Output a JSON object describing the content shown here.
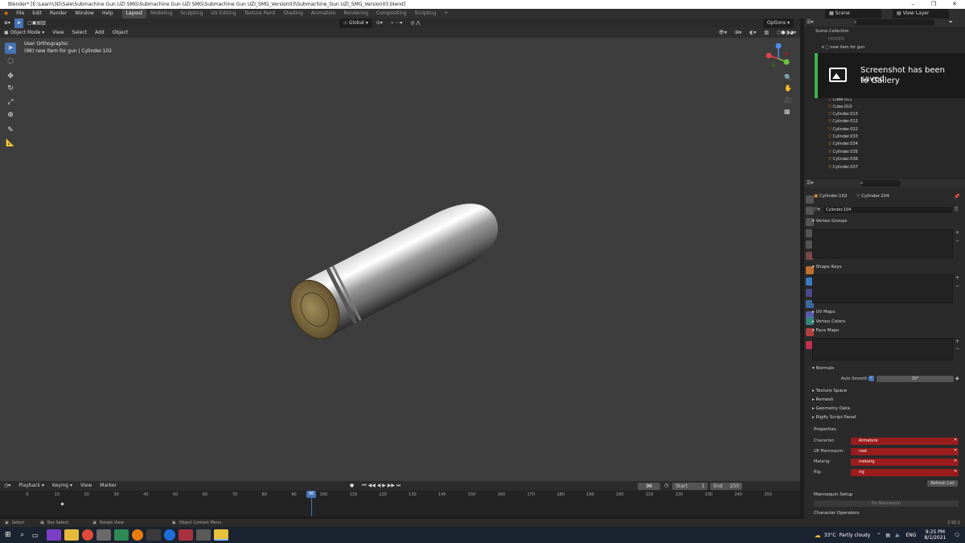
{
  "window": {
    "title": "Blender* [E:\\Learn\\3D\\Sale\\Submachine Gun UZI SMG\\Submachine Gun UZI SMG\\Submachine Gun UZI_SMG_Version03\\Submachine_Gun UZI_SMG_Version03.blend]"
  },
  "menu": [
    "File",
    "Edit",
    "Render",
    "Window",
    "Help"
  ],
  "workspaces": [
    "Layout",
    "Modeling",
    "Sculpting",
    "UV Editing",
    "Texture Paint",
    "Shading",
    "Animation",
    "Rendering",
    "Compositing",
    "Scripting"
  ],
  "active_workspace": "Layout",
  "header_right": {
    "scene": "Scene",
    "view_layer": "View Layer"
  },
  "viewport": {
    "mode": "Object Mode",
    "menus": [
      "View",
      "Select",
      "Add",
      "Object"
    ],
    "transform_orientation": "Global",
    "options_label": "Options",
    "overlay_title": "User Orthographic",
    "overlay_sub": "(96) new item for gun | Cylinder.102"
  },
  "timeline": {
    "menus": [
      "Playback",
      "Keying",
      "View",
      "Marker"
    ],
    "current_frame": "96",
    "start_label": "Start",
    "start": "1",
    "end_label": "End",
    "end": "250",
    "ticks": [
      "0",
      "10",
      "20",
      "30",
      "40",
      "50",
      "60",
      "70",
      "80",
      "90",
      "100",
      "110",
      "120",
      "130",
      "140",
      "150",
      "160",
      "170",
      "180",
      "190",
      "200",
      "210",
      "220",
      "230",
      "240",
      "250"
    ]
  },
  "status": {
    "select": "Select",
    "box_select": "Box Select",
    "rotate_view": "Rotate View",
    "context_menu": "Object Context Menu",
    "version": "2.93.1"
  },
  "outliner": {
    "title": "Scene Collection",
    "rows": [
      "HIDDEN",
      "new item for gun",
      "Cube.011",
      "Cube.010",
      "Cylinder.013",
      "Cylinder.012",
      "Cylinder.022",
      "Cylinder.033",
      "Cylinder.034",
      "Cylinder.035",
      "Cylinder.036",
      "Cylinder.037"
    ]
  },
  "notification": {
    "line1": "Screenshot has been saved",
    "line2": "to Gallery"
  },
  "properties": {
    "object": "Cylinder.102",
    "mesh": "Cylinder.104",
    "mesh_field": "Cylinder.104",
    "sections": {
      "vertex_groups": "Vertex Groups",
      "shape_keys": "Shape Keys",
      "uv_maps": "UV Maps",
      "vertex_colors": "Vertex Colors",
      "face_maps": "Face Maps",
      "normals": "Normals",
      "texture_space": "Texture Space",
      "remesh": "Remesh",
      "geometry_data": "Geometry Data",
      "rigify": "Rigify Script Panel",
      "properties": "Properties",
      "mannequin": "Mannequin Setup",
      "char_ops": "Character Operators"
    },
    "auto_smooth_label": "Auto Smooth",
    "auto_smooth_angle": "30°",
    "fields": [
      {
        "label": "Character:",
        "value": "Armature"
      },
      {
        "label": "UE Mannequin:",
        "value": "root"
      },
      {
        "label": "Metarig:",
        "value": "metarig"
      },
      {
        "label": "Rig:",
        "value": "rig"
      }
    ],
    "refresh_button": "Refresh List",
    "fix_button": "Fix Mannequin"
  },
  "taskbar": {
    "weather_temp": "33°C",
    "weather_text": "Partly cloudy",
    "lang": "ENG",
    "time": "9:25 PM",
    "date": "8/1/2021"
  },
  "colors": {
    "accent": "#4772b3",
    "red_field": "#9b1c1c",
    "green_bar": "#3cb34a",
    "playhead": "#4772b3"
  }
}
